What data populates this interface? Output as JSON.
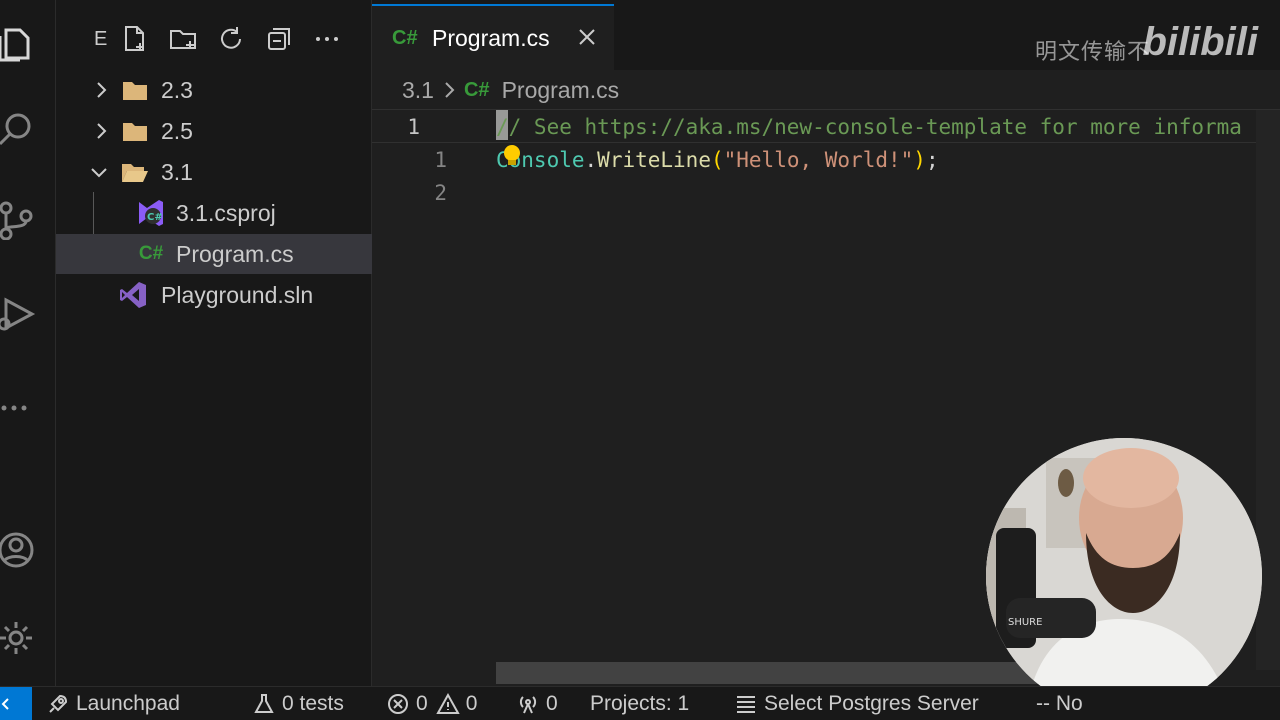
{
  "sidebar": {
    "title": "E",
    "items": [
      {
        "label": "2.3"
      },
      {
        "label": "2.5"
      },
      {
        "label": "3.1"
      },
      {
        "label": "3.1.csproj"
      },
      {
        "label": "Program.cs"
      },
      {
        "label": "Playground.sln"
      }
    ]
  },
  "tab": {
    "lang_badge": "C#",
    "label": "Program.cs"
  },
  "breadcrumb": {
    "folder": "3.1",
    "lang_badge": "C#",
    "file": "Program.cs"
  },
  "code": {
    "lines": [
      {
        "number": "1",
        "comment": "// See https://aka.ms/new-console-template for more informa"
      },
      {
        "number": "1",
        "class": "Console",
        "dot": ".",
        "method": "WriteLine",
        "open": "(",
        "string": "\"Hello, World!\"",
        "close": ")",
        "semi": ";"
      },
      {
        "number": "2"
      }
    ]
  },
  "watermark": {
    "text": "明文传输不",
    "brand": "bilibili"
  },
  "statusbar": {
    "launchpad": "Launchpad",
    "tests": "0 tests",
    "errors": "0",
    "warnings": "0",
    "ports": "0",
    "projects": "Projects: 1",
    "postgres": "Select Postgres Server",
    "trailing": "-- No"
  },
  "colors": {
    "accent": "#0078d4",
    "csharp": "#389a3a",
    "folder": "#dcb67a"
  }
}
